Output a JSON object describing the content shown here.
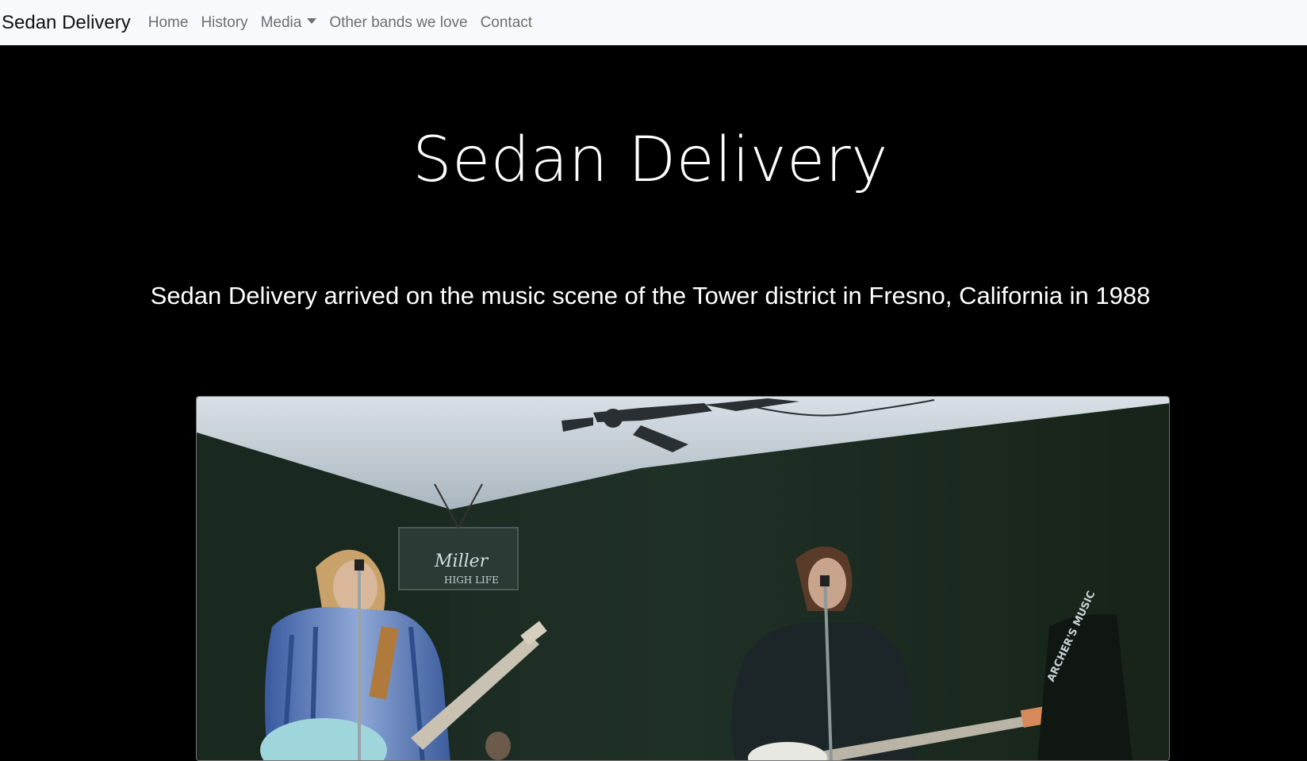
{
  "navbar": {
    "brand": "Sedan Delivery",
    "items": [
      {
        "label": "Home"
      },
      {
        "label": "History"
      },
      {
        "label": "Media",
        "dropdown": true
      },
      {
        "label": "Other bands we love"
      },
      {
        "label": "Contact"
      }
    ]
  },
  "hero": {
    "title": "Sedan Delivery",
    "subtitle": "Sedan Delivery arrived on the music scene of the Tower district in Fresno, California in 1988"
  },
  "photo": {
    "sign_brand": "Miller",
    "sign_text": "HIGH LIFE",
    "amp_text": "ARCHER'S MUSIC"
  },
  "colors": {
    "navbar_bg": "#f8f9fa",
    "page_bg": "#000000",
    "nav_text": "#6b6f73",
    "hero_text": "#ffffff"
  }
}
